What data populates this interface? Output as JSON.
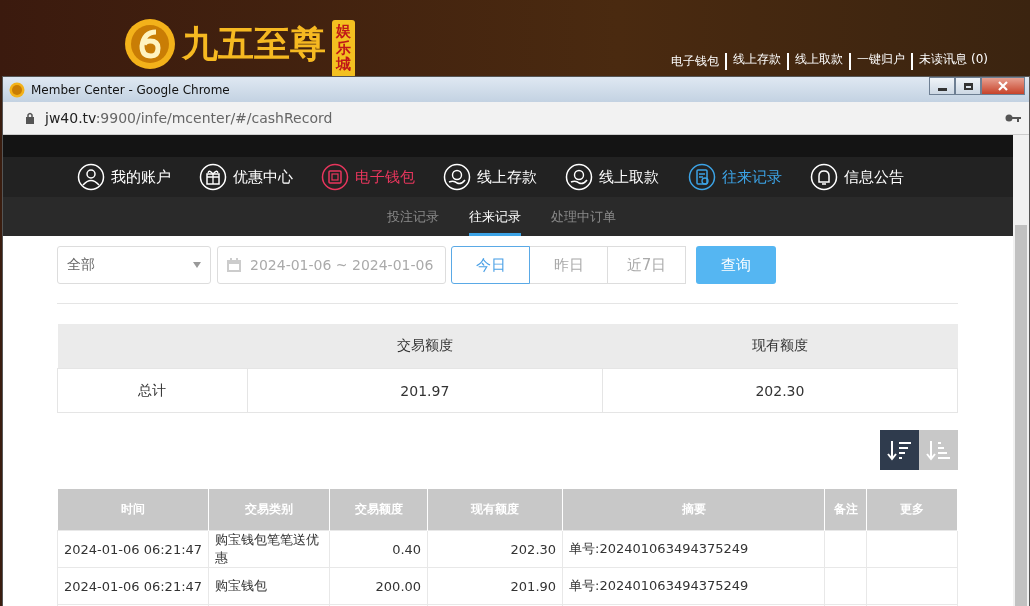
{
  "site": {
    "logo_text": "九五至尊",
    "logo_badge": "娱乐城",
    "links": [
      "电子钱包",
      "线上存款",
      "线上取款",
      "一键归户",
      "未读讯息 (0)"
    ]
  },
  "window": {
    "title": "Member Center - Google Chrome",
    "url_host": "jw40.tv",
    "url_rest": ":9900/infe/mcenter/#/cashRecord"
  },
  "nav": [
    {
      "label": "我的账户",
      "color": "#ffffff"
    },
    {
      "label": "优惠中心",
      "color": "#ffffff"
    },
    {
      "label": "电子钱包",
      "color": "#e8365d"
    },
    {
      "label": "线上存款",
      "color": "#ffffff"
    },
    {
      "label": "线上取款",
      "color": "#ffffff"
    },
    {
      "label": "往来记录",
      "color": "#3ca3e6"
    },
    {
      "label": "信息公告",
      "color": "#ffffff"
    }
  ],
  "subtabs": [
    {
      "label": "投注记录",
      "selected": false
    },
    {
      "label": "往来记录",
      "selected": true
    },
    {
      "label": "处理中订单",
      "selected": false
    }
  ],
  "filter": {
    "type": "全部",
    "date_range": "2024-01-06 ~ 2024-01-06",
    "quick": [
      {
        "label": "今日",
        "selected": true
      },
      {
        "label": "昨日",
        "selected": false
      },
      {
        "label": "近7日",
        "selected": false
      }
    ],
    "search_button": "查询"
  },
  "summary": {
    "columns": [
      "交易额度",
      "现有额度"
    ],
    "row": [
      "总计",
      "201.97",
      "202.30"
    ]
  },
  "sort_buttons": [
    {
      "kind": "desc",
      "selected": true
    },
    {
      "kind": "asc",
      "selected": false
    }
  ],
  "table": {
    "columns": [
      "时间",
      "交易类别",
      "交易额度",
      "现有额度",
      "摘要",
      "备注",
      "更多"
    ],
    "rows": [
      [
        "2024-01-06 06:21:47",
        "购宝钱包笔笔送优惠",
        "0.40",
        "202.30",
        "单号:202401063494375249",
        "",
        ""
      ],
      [
        "2024-01-06 06:21:47",
        "购宝钱包",
        "200.00",
        "201.90",
        "单号:202401063494375249",
        "",
        ""
      ]
    ]
  }
}
